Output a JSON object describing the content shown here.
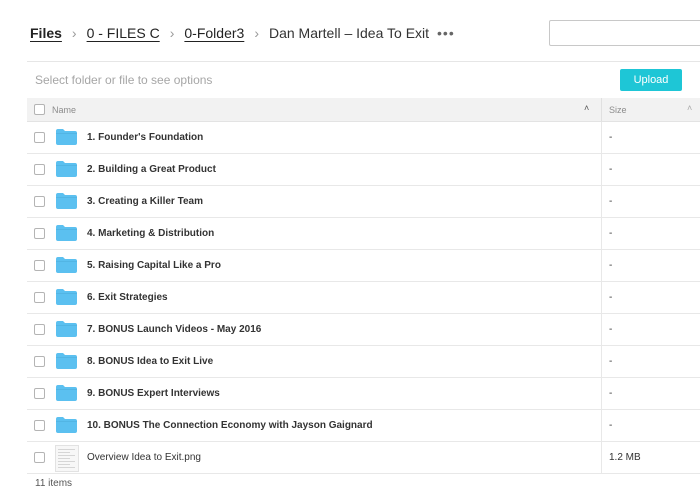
{
  "breadcrumb": {
    "root": "Files",
    "items": [
      "0 - FILES C",
      "0-Folder3"
    ],
    "current": "Dan Martell – Idea To Exit",
    "separator": "›",
    "more": "•••"
  },
  "search": {
    "placeholder": ""
  },
  "actions": {
    "hint": "Select folder or file to see options",
    "upload_label": "Upload"
  },
  "table": {
    "columns": {
      "name": "Name",
      "size": "Size",
      "sort_icon": "˄"
    },
    "rows": [
      {
        "name": "1. Founder's Foundation",
        "size": "-",
        "type": "folder"
      },
      {
        "name": "2. Building a Great Product",
        "size": "-",
        "type": "folder"
      },
      {
        "name": "3. Creating a Killer Team",
        "size": "-",
        "type": "folder"
      },
      {
        "name": "4. Marketing & Distribution",
        "size": "-",
        "type": "folder"
      },
      {
        "name": "5. Raising Capital Like a Pro",
        "size": "-",
        "type": "folder"
      },
      {
        "name": "6. Exit Strategies",
        "size": "-",
        "type": "folder"
      },
      {
        "name": "7. BONUS Launch Videos - May 2016",
        "size": "-",
        "type": "folder"
      },
      {
        "name": "8. BONUS Idea to Exit Live",
        "size": "-",
        "type": "folder"
      },
      {
        "name": "9. BONUS Expert Interviews",
        "size": "-",
        "type": "folder"
      },
      {
        "name": "10. BONUS The Connection Economy with Jayson Gaignard",
        "size": "-",
        "type": "folder"
      },
      {
        "name": "Overview Idea to Exit.png",
        "size": "1.2 MB",
        "type": "file"
      }
    ]
  },
  "footer": {
    "count": "11 items"
  },
  "colors": {
    "accent": "#1ec6d6",
    "folder": "#5bc0f0"
  },
  "icons": {
    "folder": "folder-icon",
    "file": "image-file-icon",
    "sort": "chevron-up-icon"
  }
}
